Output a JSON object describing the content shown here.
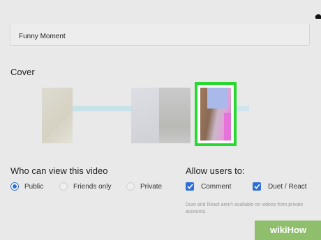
{
  "caption": {
    "value": "Funny Moment"
  },
  "cover": {
    "title": "Cover"
  },
  "visibility": {
    "title": "Who can view this video",
    "options": [
      "Public",
      "Friends only",
      "Private"
    ],
    "selected": "Public"
  },
  "allow": {
    "title": "Allow users to:",
    "options": [
      "Comment",
      "Duet / React"
    ],
    "note": "Duet and React aren't available on videos from private accounts."
  },
  "watermark": {
    "text": "wikiHow"
  },
  "colors": {
    "accent": "#2d6fd6",
    "cover_selected": "#27d92f"
  }
}
